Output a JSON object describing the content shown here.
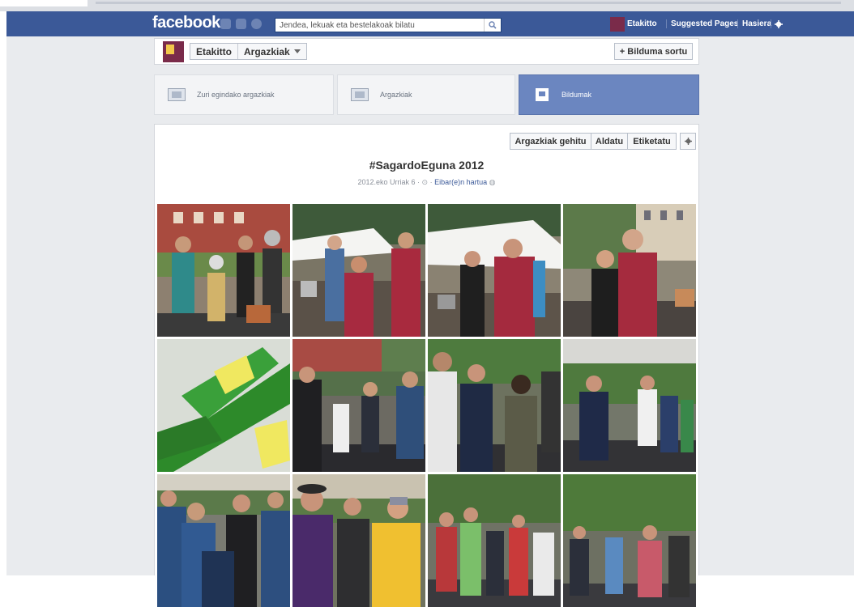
{
  "topbar": {
    "logo": "facebook",
    "search_placeholder": "Jendea, lekuak eta bestelakoak bilatu",
    "nav": [
      "Etakitto",
      "Suggested Pages",
      "Hasiera"
    ]
  },
  "header": {
    "page_name": "Etakitto",
    "section": "Argazkiak",
    "create_album": "+ Bilduma sortu"
  },
  "tabs": [
    {
      "label": "Zuri egindako argazkiak",
      "active": false
    },
    {
      "label": "Argazkiak",
      "active": false
    },
    {
      "label": "Bildumak",
      "active": true
    }
  ],
  "album": {
    "actions": [
      "Argazkiak gehitu",
      "Aldatu",
      "Etiketatu"
    ],
    "title": "#SagardoEguna 2012",
    "date": "2012.eko Urriak 6",
    "location": "Eibar(e)n hartua",
    "photos": [
      {
        "alt": "photo-1"
      },
      {
        "alt": "photo-2"
      },
      {
        "alt": "photo-3"
      },
      {
        "alt": "photo-4"
      },
      {
        "alt": "photo-5"
      },
      {
        "alt": "photo-6"
      },
      {
        "alt": "photo-7"
      },
      {
        "alt": "photo-8"
      },
      {
        "alt": "photo-9"
      },
      {
        "alt": "photo-10"
      },
      {
        "alt": "photo-11"
      },
      {
        "alt": "photo-12"
      }
    ]
  },
  "colors": {
    "fb_blue": "#3b5998",
    "active_tab": "#6b86c0",
    "page_bg": "#e9ebee"
  }
}
